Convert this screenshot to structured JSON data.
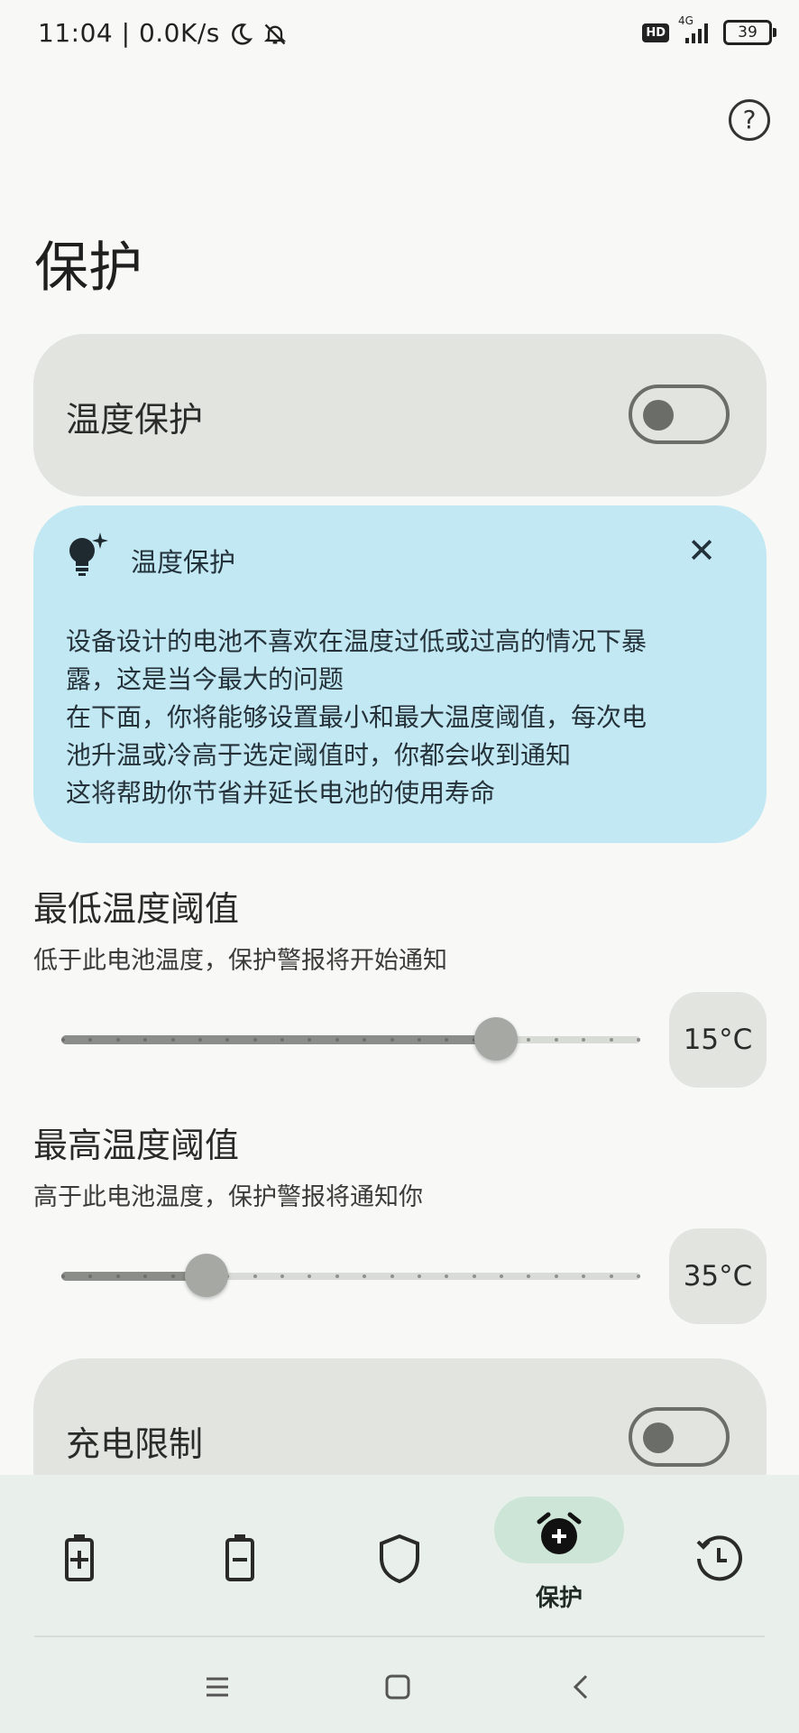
{
  "status_bar": {
    "time": "11:04",
    "speed": "0.0K/s",
    "hd": "HD",
    "network": "4G",
    "battery": "39"
  },
  "page": {
    "title": "保护"
  },
  "temp_protection_card": {
    "label": "温度保护",
    "toggle_on": false
  },
  "tip": {
    "title": "温度保护",
    "lines": [
      "设备设计的电池不喜欢在温度过低或过高的情况下暴",
      "露，这是当今最大的问题",
      "在下面，你将能够设置最小和最大温度阈值，每次电",
      "池升温或冷高于选定阈值时，你都会收到通知",
      "这将帮助你节省并延长电池的使用寿命"
    ]
  },
  "min_threshold": {
    "title": "最低温度阈值",
    "subtitle": "低于此电池温度，保护警报将开始通知",
    "value_label": "15°C",
    "fraction": 0.75
  },
  "max_threshold": {
    "title": "最高温度阈值",
    "subtitle": "高于此电池温度，保护警报将通知你",
    "value_label": "35°C",
    "fraction": 0.25
  },
  "charge_limit_card": {
    "label": "充电限制",
    "toggle_on": false
  },
  "bottom_nav": {
    "active_label": "保护",
    "items": [
      "battery-charging-icon",
      "battery-icon",
      "shield-icon",
      "alarm-icon",
      "history-icon"
    ]
  },
  "colors": {
    "tip_bg": "#c2e8f4",
    "card_bg": "#e2e4df",
    "nav_active": "#cde5d6"
  }
}
